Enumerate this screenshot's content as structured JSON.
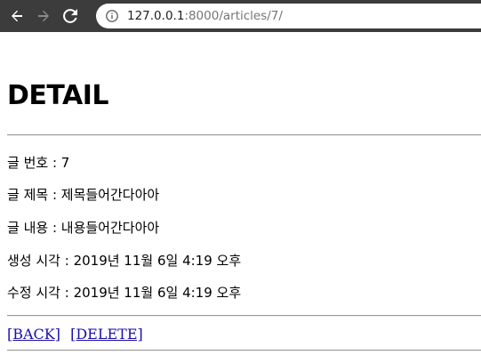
{
  "browser": {
    "url_host": "127.0.0.1",
    "url_rest": ":8000/articles/7/",
    "icons": [
      "back-arrow-icon",
      "forward-arrow-icon",
      "reload-icon",
      "info-icon"
    ]
  },
  "page": {
    "title": "DETAIL",
    "fields": [
      {
        "label": "글 번호",
        "value": "7"
      },
      {
        "label": "글 제목",
        "value": "제목들어간다아아"
      },
      {
        "label": "글 내용",
        "value": "내용들어간다아아"
      },
      {
        "label": "생성 시각",
        "value": "2019년 11월 6일 4:19 오후"
      },
      {
        "label": "수정 시각",
        "value": "2019년 11월 6일 4:19 오후"
      }
    ],
    "links": {
      "back": "[BACK]",
      "delete": "[DELETE]"
    }
  }
}
